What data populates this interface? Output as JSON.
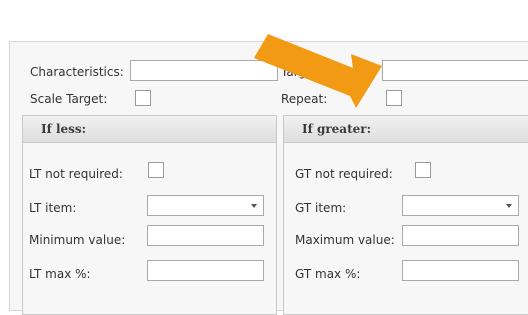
{
  "top": {
    "characteristics_label": "Characteristics:",
    "target_label": "Target:",
    "scale_target_label": "Scale Target:",
    "repeat_label": "Repeat:"
  },
  "if_less": {
    "title": "If less:",
    "lt_not_required_label": "LT not required:",
    "lt_item_label": "LT item:",
    "minimum_value_label": "Minimum value:",
    "lt_max_label": "LT max %:"
  },
  "if_greater": {
    "title": "If greater:",
    "gt_not_required_label": "GT not required:",
    "gt_item_label": "GT item:",
    "maximum_value_label": "Maximum value:",
    "gt_max_label": "GT max %:"
  },
  "overlay": {
    "arrow_color": "#f39a14"
  }
}
